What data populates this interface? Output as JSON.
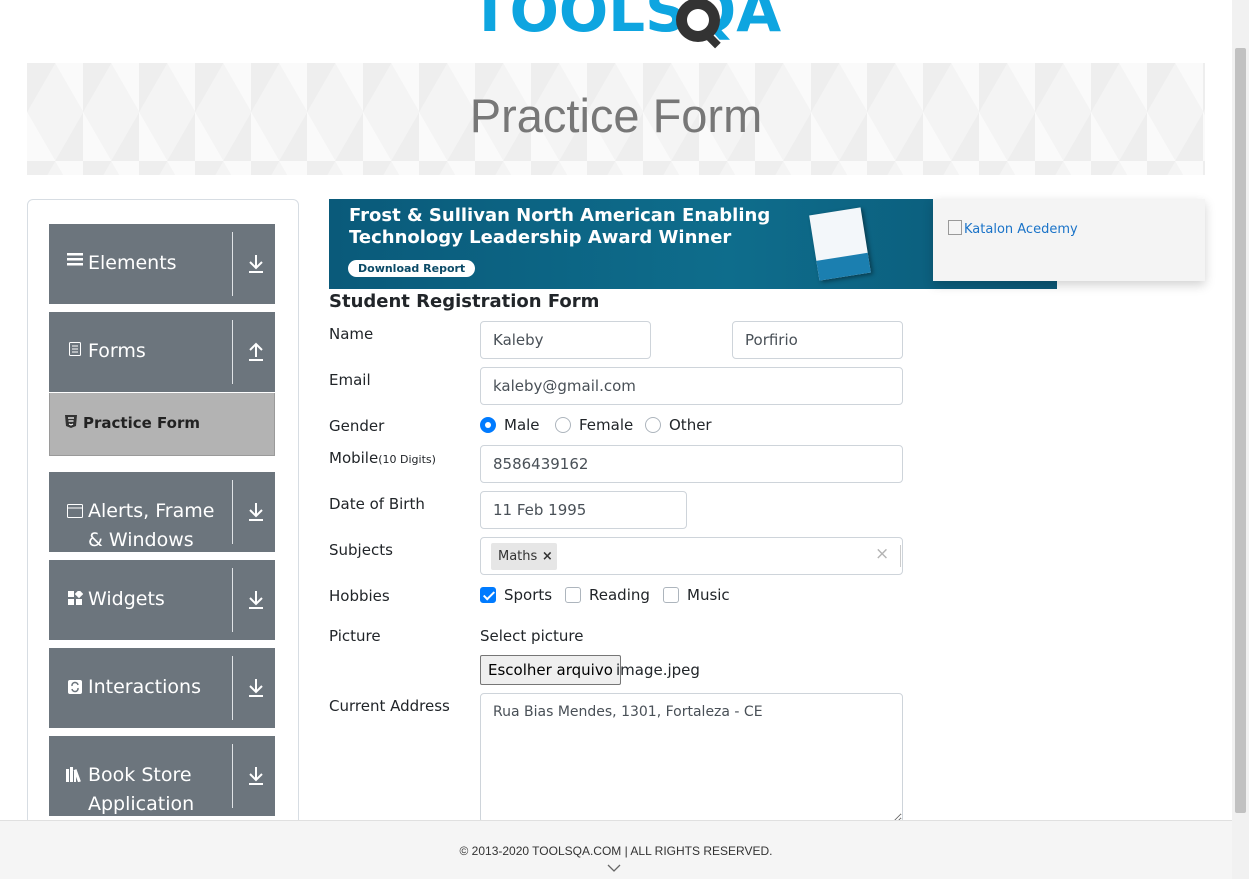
{
  "logo": {
    "text": "TOOLSQA"
  },
  "header": {
    "title": "Practice Form"
  },
  "sidebar": {
    "groups": [
      {
        "label": "Elements",
        "icon": "hamburger-icon",
        "toggle_icon": "download-arrow-icon"
      },
      {
        "label": "Forms",
        "icon": "document-icon",
        "toggle_icon": "upload-arrow-icon"
      },
      {
        "label": "Alerts, Frame & Windows",
        "icon": "window-icon",
        "toggle_icon": "download-arrow-icon"
      },
      {
        "label": "Widgets",
        "icon": "widgets-icon",
        "toggle_icon": "download-arrow-icon"
      },
      {
        "label": "Interactions",
        "icon": "interactions-icon",
        "toggle_icon": "download-arrow-icon"
      },
      {
        "label": "Book Store Application",
        "icon": "books-icon",
        "toggle_icon": "download-arrow-icon"
      }
    ],
    "active_item": {
      "label": "Practice Form",
      "icon": "html5-icon"
    }
  },
  "ad": {
    "headline_line1": "Frost & Sullivan North American Enabling",
    "headline_line2": "Technology Leadership Award Winner",
    "cta": "Download Report",
    "side_alt": "Katalon Acedemy"
  },
  "form": {
    "title": "Student Registration Form",
    "name_label": "Name",
    "first_name": "Kaleby",
    "last_name": "Porfirio",
    "email_label": "Email",
    "email": "kaleby@gmail.com",
    "gender_label": "Gender",
    "gender_options": [
      "Male",
      "Female",
      "Other"
    ],
    "gender_selected": "Male",
    "mobile_label": "Mobile",
    "mobile_hint": "(10 Digits)",
    "mobile": "8586439162",
    "dob_label": "Date of Birth",
    "dob": "11 Feb 1995",
    "subjects_label": "Subjects",
    "subjects": [
      "Maths"
    ],
    "subject_remove": "×",
    "subjects_clear": "×",
    "hobbies_label": "Hobbies",
    "hobbies": [
      "Sports",
      "Reading",
      "Music"
    ],
    "hobbies_checked": [
      "Sports"
    ],
    "picture_label": "Picture",
    "picture_prompt": "Select picture",
    "file_button": "Escolher arquivo",
    "file_name": "image.jpeg",
    "address_label": "Current Address",
    "address": "Rua Bias Mendes, 1301, Fortaleza - CE"
  },
  "footer": {
    "copyright": "© 2013-2020 TOOLSQA.COM | ALL RIGHTS RESERVED."
  },
  "colors": {
    "accent": "#007bff",
    "sidebar_bg": "#6c757d",
    "active_bg": "#b3b3b3",
    "logo_blue": "#0ea5e0",
    "logo_dark": "#333333"
  }
}
